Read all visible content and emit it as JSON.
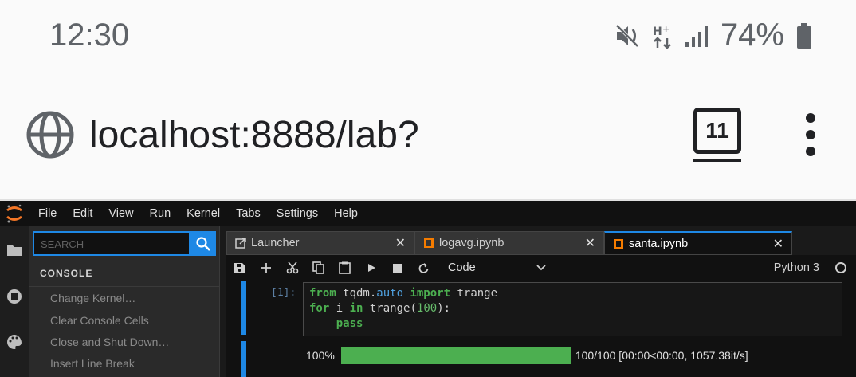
{
  "status_bar": {
    "time": "12:30",
    "battery": "74%"
  },
  "browser": {
    "url": "localhost:8888/lab?",
    "tab_count": "11"
  },
  "jupyter": {
    "menu": [
      "File",
      "Edit",
      "View",
      "Run",
      "Kernel",
      "Tabs",
      "Settings",
      "Help"
    ],
    "sidebar": {
      "search_placeholder": "SEARCH",
      "section_title": "CONSOLE",
      "commands": [
        "Change Kernel…",
        "Clear Console Cells",
        "Close and Shut Down…",
        "Insert Line Break"
      ]
    },
    "tabs": [
      {
        "label": "Launcher",
        "icon": "launcher-icon",
        "active": false
      },
      {
        "label": "logavg.ipynb",
        "icon": "notebook-icon",
        "active": false
      },
      {
        "label": "santa.ipynb",
        "icon": "notebook-icon",
        "active": true
      }
    ],
    "toolbar": {
      "cell_type": "Code",
      "kernel": "Python 3"
    },
    "cell": {
      "prompt": "[1]:",
      "code_lines": [
        {
          "kw1": "from",
          "mod": " tqdm.",
          "attr": "auto",
          "kw2": " import",
          "rest": " trange"
        },
        {
          "kw1": "for",
          "mid1": " i ",
          "kw2": "in",
          "mid2": " trange(",
          "num": "100",
          "end": "):"
        },
        {
          "indent": "    ",
          "kw": "pass"
        }
      ]
    },
    "output": {
      "percent": "100%",
      "progress_fraction": 1.0,
      "stats": "100/100 [00:00<00:00, 1057.38it/s]"
    }
  },
  "colors": {
    "accent": "#1e88e5",
    "progress": "#4caf50",
    "notebook_icon": "#f57c00"
  }
}
